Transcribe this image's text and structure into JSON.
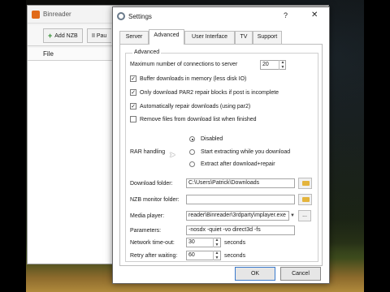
{
  "background_app": {
    "title": "Binreader",
    "add_nzb_label": "Add NZB",
    "pause_label": "II Pau",
    "list_header": "File"
  },
  "dialog": {
    "title": "Settings",
    "help": "?",
    "close": "✕",
    "tabs": [
      {
        "label": "Server",
        "active": false
      },
      {
        "label": "Advanced",
        "active": true
      },
      {
        "label": "User Interface",
        "active": false
      },
      {
        "label": "TV",
        "active": false
      },
      {
        "label": "Support",
        "active": false
      }
    ],
    "group_label": "Advanced",
    "max_connections": {
      "label": "Maximum number of connections to server",
      "value": "20"
    },
    "checkboxes": [
      {
        "label": "Buffer downloads in memory (less disk IO)",
        "checked": true
      },
      {
        "label": "Only download PAR2 repair blocks if post is incomplete",
        "checked": true
      },
      {
        "label": "Automatically repair downloads (using par2)",
        "checked": true
      },
      {
        "label": "Remove files from download list when finished",
        "checked": false
      }
    ],
    "rar": {
      "label": "RAR handling",
      "options": [
        {
          "label": "Disabled",
          "selected": true
        },
        {
          "label": "Start extracting while you download",
          "selected": false
        },
        {
          "label": "Extract after download+repair",
          "selected": false
        }
      ]
    },
    "download_folder": {
      "label": "Download folder:",
      "value": "C:\\Users\\Patrick\\Downloads"
    },
    "nzb_monitor": {
      "label": "NZB monitor folder:",
      "value": ""
    },
    "media_player": {
      "label": "Media player:",
      "value": "reader\\Binreader\\3rdparty\\mplayer.exe",
      "browse": "..."
    },
    "parameters": {
      "label": "Parameters:",
      "value": "-nosdx -quiet -vo direct3d -fs"
    },
    "timeout": {
      "label": "Network time-out:",
      "value": "30",
      "unit": "seconds"
    },
    "retry": {
      "label": "Retry after waiting:",
      "value": "60",
      "unit": "seconds"
    },
    "ok_label": "OK",
    "cancel_label": "Cancel"
  }
}
